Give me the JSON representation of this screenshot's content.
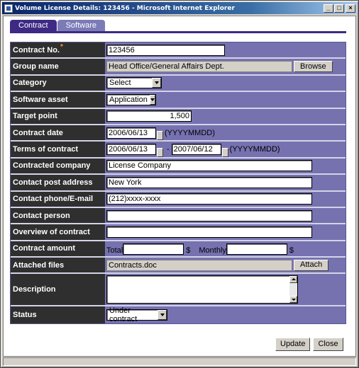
{
  "window": {
    "title": "Volume License Details: 123456 - Microsoft Internet Explorer",
    "minimize": "_",
    "maximize": "□",
    "close": "×"
  },
  "tabs": [
    {
      "label": "Contract",
      "active": true
    },
    {
      "label": "Software",
      "active": false
    }
  ],
  "form": {
    "contract_no": {
      "label": "Contract No.",
      "required_mark": "*",
      "value": "123456"
    },
    "group_name": {
      "label": "Group name",
      "value": "Head Office/General Affairs Dept.",
      "button": "Browse"
    },
    "category": {
      "label": "Category",
      "selected": "Select"
    },
    "software_asset": {
      "label": "Software asset",
      "selected": "Application"
    },
    "target_point": {
      "label": "Target point",
      "value": "1,500"
    },
    "contract_date": {
      "label": "Contract date",
      "value": "2006/06/13",
      "format": "(YYYYMMDD)"
    },
    "terms": {
      "label": "Terms of contract",
      "from": "2006/06/13",
      "separator": "-",
      "to": "2007/06/12",
      "format": "(YYYYMMDD)"
    },
    "company": {
      "label": "Contracted company",
      "value": "License Company"
    },
    "post_address": {
      "label": "Contact post address",
      "value": "New York"
    },
    "phone_email": {
      "label": "Contact phone/E-mail",
      "value": "(212)xxxx-xxxx"
    },
    "person": {
      "label": "Contact person",
      "value": ""
    },
    "overview": {
      "label": "Overview of contract",
      "value": ""
    },
    "amount": {
      "label": "Contract amount",
      "total_label": "Total",
      "total_value": "",
      "currency": "$",
      "monthly_label": "Monthly",
      "monthly_value": "",
      "currency2": "$"
    },
    "attached": {
      "label": "Attached files",
      "value": "Contracts.doc",
      "button": "Attach"
    },
    "description": {
      "label": "Description",
      "value": ""
    },
    "status": {
      "label": "Status",
      "selected": "Under contract"
    }
  },
  "actions": {
    "update": "Update",
    "close": "Close"
  },
  "colors": {
    "tab_active": "#3e2a84",
    "form_bg": "#7672b0",
    "label_bg": "#2f2f2f",
    "required": "#ff9d1c"
  }
}
